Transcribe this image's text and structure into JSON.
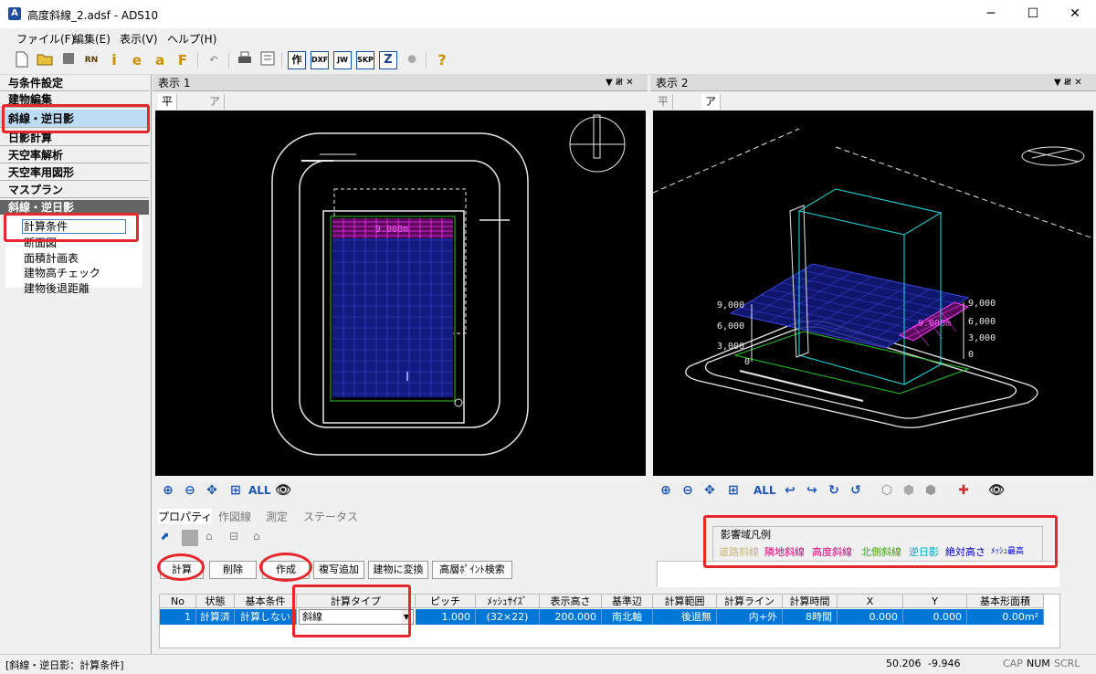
{
  "window": {
    "title": "高度斜線_2.adsf - ADS10",
    "app_icon": "A",
    "minimize": "─",
    "maximize": "☐",
    "close": "✕"
  },
  "menu": [
    "ファイル(F)",
    "編集(E)",
    "表示(V)",
    "ヘルプ(H)"
  ],
  "toolbar": {
    "items": [
      "new-file-icon",
      "open-folder-icon",
      "stop-icon",
      "rn-icon",
      "info-icon",
      "e-icon",
      "a-icon",
      "f-icon",
      "undo-icon",
      "print-icon",
      "properties-icon",
      "作",
      "DXF",
      "JW",
      "SKP",
      "Z",
      "nav-icon",
      "help-icon"
    ],
    "labels": {
      "rn": "RN",
      "info": "i",
      "e": "e",
      "a": "a",
      "f": "F",
      "sak": "作",
      "dxf": "DXF",
      "jw": "JW",
      "skp": "SKP",
      "z": "Z",
      "help": "?"
    }
  },
  "sidebar": {
    "headers": [
      "与条件設定",
      "建物編集",
      "斜線・逆日影",
      "日影計算",
      "天空率解析",
      "天空率用図形",
      "マスプラン"
    ],
    "section": "斜線・逆日影",
    "items": [
      "計算条件",
      "断面図",
      "面積計画表",
      "建物高チェック",
      "建物後退距離"
    ]
  },
  "view1": {
    "title": "表示 1",
    "tabs": [
      "平面図",
      "アイソメ図"
    ],
    "label": "9.000m",
    "zoom_all": "ALL"
  },
  "view2": {
    "title": "表示 2",
    "tabs": [
      "平面図",
      "アイソメ図"
    ],
    "labels_left": [
      "9,000",
      "6,000",
      "3,000",
      "0"
    ],
    "labels_right": [
      "9,000",
      "6,000",
      "3,000",
      "0"
    ],
    "label_center": "9.000m",
    "zoom_all": "ALL"
  },
  "bottom": {
    "tabs": [
      "プロパティ",
      "作図線",
      "測定",
      "ステータス"
    ],
    "buttons": [
      "計算",
      "削除",
      "作成",
      "複写追加",
      "建物に変換",
      "高層ﾎﾟｲﾝﾄ検索"
    ],
    "legend": {
      "title": "影響域凡例",
      "items": [
        {
          "label": "道路斜線",
          "color": "#c8b478"
        },
        {
          "label": "隣地斜線",
          "color": "#d8007a"
        },
        {
          "label": "高度斜線",
          "color": "#d8007a"
        },
        {
          "label": "北側斜線",
          "color": "#3aa000"
        },
        {
          "label": "逆日影",
          "color": "#00a8b8"
        },
        {
          "label": "絶対高さ",
          "color": "#0000b0"
        },
        {
          "label": "ﾒｯｼｭ最高",
          "color": "#0000e0"
        }
      ]
    },
    "table": {
      "headers": [
        "No",
        "状態",
        "基本条件",
        "計算タイプ",
        "ピッチ",
        "ﾒｯｼｭｻｲｽﾞ",
        "表示高さ",
        "基準辺",
        "計算範囲",
        "計算ライン",
        "計算時間",
        "X",
        "Y",
        "基本形面積"
      ],
      "row": [
        "1",
        "計算済",
        "計算しない",
        "斜線",
        "1.000",
        "(32×22)",
        "200.000",
        "南北軸",
        "後退無",
        "内+外",
        "8時間",
        "0.000",
        "0.000",
        "0.00m²"
      ]
    }
  },
  "status": {
    "left": "[斜線・逆日影：計算条件]",
    "x": "50.206",
    "y": "-9.946",
    "cap": "CAP",
    "num": "NUM",
    "scrl": "SCRL"
  },
  "colors": {
    "accent": "#0077d7",
    "highlight": "#e8262b"
  }
}
